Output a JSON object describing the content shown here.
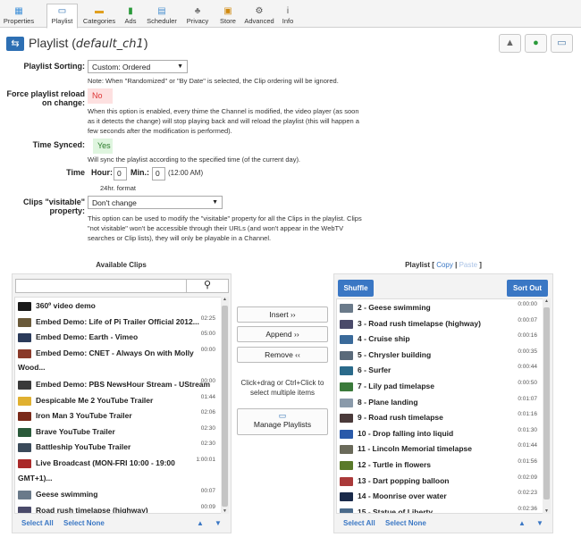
{
  "tabs": [
    {
      "label": "Properties",
      "icon": "properties-icon",
      "glyph": "▦",
      "color": "#3d8fd8"
    },
    {
      "label": "Playlist",
      "icon": "playlist-icon",
      "glyph": "▭",
      "color": "#2d6fb3"
    },
    {
      "label": "Categories",
      "icon": "folder-icon",
      "glyph": "▬",
      "color": "#e0a020"
    },
    {
      "label": "Ads",
      "icon": "ads-icon",
      "glyph": "▮",
      "color": "#2a9a3a"
    },
    {
      "label": "Scheduler",
      "icon": "calendar-icon",
      "glyph": "▤",
      "color": "#4a90d0"
    },
    {
      "label": "Privacy",
      "icon": "privacy-icon",
      "glyph": "♣",
      "color": "#777"
    },
    {
      "label": "Store",
      "icon": "store-icon",
      "glyph": "▣",
      "color": "#d08a10"
    },
    {
      "label": "Advanced",
      "icon": "gear-icon",
      "glyph": "⚙",
      "color": "#555"
    },
    {
      "label": "Info",
      "icon": "info-icon",
      "glyph": "i",
      "color": "#555"
    }
  ],
  "header": {
    "title": "Playlist",
    "channel": "default_ch1"
  },
  "toolbar": {
    "icons": [
      "upload-icon",
      "play-icon",
      "monitor-icon"
    ]
  },
  "form": {
    "sorting_label": "Playlist Sorting:",
    "sorting_value": "Custom: Ordered",
    "sorting_note": "Note: When \"Randomized\" or \"By Date\" is selected, the Clip ordering will be ignored.",
    "force_label_1": "Force playlist reload",
    "force_label_2": "on change:",
    "force_value": "No",
    "force_note_1": "When this option is enabled, every thime the Channel is modified, the video player (as soon",
    "force_note_2": "as it detects the change) will stop playing back and will reload the playlist (this will happen a",
    "force_note_3": "few seconds after the modification is performed).",
    "synced_label": "Time Synced:",
    "synced_value": "Yes",
    "synced_note": "Will sync the playlist according to the specified time (of the current day).",
    "time_label": "Time",
    "hour_label": "Hour:",
    "hour_value": "0",
    "min_label": "Min.:",
    "min_value": "0",
    "time_display": "(12:00 AM)",
    "time_format": "24hr. format",
    "visitable_label_1": "Clips \"visitable\"",
    "visitable_label_2": "property:",
    "visitable_value": "Don't change",
    "visitable_note_1": "This option can be used to modify the \"visitable\" property for all the Clips in the playlist. Clips",
    "visitable_note_2": "\"not visitable\" won't be accessible through their URLs (and won't appear in the WebTV",
    "visitable_note_3": "searches or Clip lists), they will only be playable in a Channel."
  },
  "available": {
    "title": "Available Clips",
    "search_placeholder": "",
    "select_all": "Select All",
    "select_none": "Select None",
    "items": [
      {
        "title": "360º video demo",
        "time": "",
        "color": "#1a1a1a",
        "wrap": ""
      },
      {
        "title": "Embed Demo: Life of Pi Trailer Official 2012...",
        "time": "02:25",
        "color": "#6a5a3a",
        "wrap": ""
      },
      {
        "title": "Embed Demo: Earth - Vimeo",
        "time": "05:00",
        "color": "#2a3a5a",
        "wrap": ""
      },
      {
        "title": "Embed Demo: CNET - Always On with Molly",
        "time": "00:00",
        "color": "#8a3a2a",
        "wrap": "Wood..."
      },
      {
        "title": "Embed Demo: PBS NewsHour Stream - UStream",
        "time": "00:00",
        "color": "#3a3a3a",
        "wrap": ""
      },
      {
        "title": "Despicable Me 2 YouTube Trailer",
        "time": "01:44",
        "color": "#e0b030",
        "wrap": ""
      },
      {
        "title": "Iron Man 3 YouTube Trailer",
        "time": "02:06",
        "color": "#7a2a1a",
        "wrap": ""
      },
      {
        "title": "Brave YouTube Trailer",
        "time": "02:30",
        "color": "#2a5a3a",
        "wrap": ""
      },
      {
        "title": "Battleship YouTube Trailer",
        "time": "02:30",
        "color": "#3a4a5a",
        "wrap": ""
      },
      {
        "title": "Live Broadcast (MON-FRI 10:00 - 19:00",
        "time": "1:00:01",
        "color": "#aa2a2a",
        "wrap": "GMT+1)..."
      },
      {
        "title": "Geese swimming",
        "time": "00:07",
        "color": "#6a7a8a",
        "wrap": ""
      },
      {
        "title": "Road rush timelapse (highway)",
        "time": "00:09",
        "color": "#4a4a6a",
        "wrap": ""
      }
    ]
  },
  "actions": {
    "insert": "Insert ››",
    "append": "Append ››",
    "remove": "Remove ‹‹",
    "hint_1": "Click+drag or Ctrl+Click to",
    "hint_2": "select multiple items",
    "manage": "Manage Playlists"
  },
  "playlist": {
    "title": "Playlist",
    "copy": "Copy",
    "paste": "Paste",
    "shuffle": "Shuffle",
    "sort_out": "Sort Out",
    "select_all": "Select All",
    "select_none": "Select None",
    "items": [
      {
        "title": "2 - Geese swimming",
        "time": "0:00:00",
        "color": "#6a7a8a"
      },
      {
        "title": "3 - Road rush timelapse (highway)",
        "time": "0:00:07",
        "color": "#4a4a6a"
      },
      {
        "title": "4 - Cruise ship",
        "time": "0:00:16",
        "color": "#3a6a9a"
      },
      {
        "title": "5 - Chrysler building",
        "time": "0:00:35",
        "color": "#5a6a7a"
      },
      {
        "title": "6 - Surfer",
        "time": "0:00:44",
        "color": "#2a6a8a"
      },
      {
        "title": "7 - Lily pad timelapse",
        "time": "0:00:50",
        "color": "#3a7a3a"
      },
      {
        "title": "8 - Plane landing",
        "time": "0:01:07",
        "color": "#8a9aaa"
      },
      {
        "title": "9 - Road rush timelapse",
        "time": "0:01:16",
        "color": "#4a3a3a"
      },
      {
        "title": "10 - Drop falling into liquid",
        "time": "0:01:30",
        "color": "#2a5aaa"
      },
      {
        "title": "11 - Lincoln Memorial timelapse",
        "time": "0:01:44",
        "color": "#6a6a5a"
      },
      {
        "title": "12 - Turtle in flowers",
        "time": "0:01:56",
        "color": "#5a7a2a"
      },
      {
        "title": "13 - Dart popping balloon",
        "time": "0:02:09",
        "color": "#aa3a3a"
      },
      {
        "title": "14 - Moonrise over water",
        "time": "0:02:23",
        "color": "#1a2a4a"
      },
      {
        "title": "15 - Statue of Liberty",
        "time": "0:02:36",
        "color": "#4a6a8a"
      }
    ]
  }
}
